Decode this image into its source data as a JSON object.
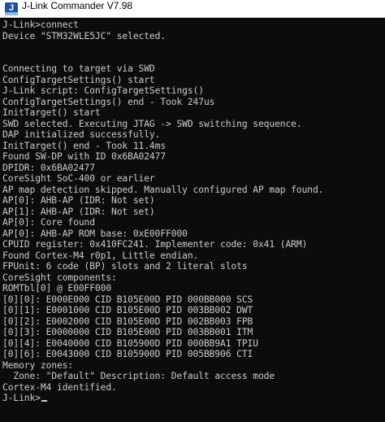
{
  "window": {
    "title": "J-Link Commander V7.98",
    "icon": "j-link-app-icon"
  },
  "console": {
    "lines": [
      "J-Link>connect",
      "Device \"STM32WLE5JC\" selected.",
      "",
      "",
      "Connecting to target via SWD",
      "ConfigTargetSettings() start",
      "J-Link script: ConfigTargetSettings()",
      "ConfigTargetSettings() end - Took 247us",
      "InitTarget() start",
      "SWD selected. Executing JTAG -> SWD switching sequence.",
      "DAP initialized successfully.",
      "InitTarget() end - Took 11.4ms",
      "Found SW-DP with ID 0x6BA02477",
      "DPIDR: 0x6BA02477",
      "CoreSight SoC-400 or earlier",
      "AP map detection skipped. Manually configured AP map found.",
      "AP[0]: AHB-AP (IDR: Not set)",
      "AP[1]: AHB-AP (IDR: Not set)",
      "AP[0]: Core found",
      "AP[0]: AHB-AP ROM base: 0xE00FF000",
      "CPUID register: 0x410FC241. Implementer code: 0x41 (ARM)",
      "Found Cortex-M4 r0p1, Little endian.",
      "FPUnit: 6 code (BP) slots and 2 literal slots",
      "CoreSight components:",
      "ROMTbl[0] @ E00FF000",
      "[0][0]: E000E000 CID B105E00D PID 000BB000 SCS",
      "[0][1]: E0001000 CID B105E00D PID 003BB002 DWT",
      "[0][2]: E0002000 CID B105E00D PID 002BB003 FPB",
      "[0][3]: E0000000 CID B105E00D PID 003BB001 ITM",
      "[0][4]: E0040000 CID B105900D PID 000BB9A1 TPIU",
      "[0][6]: E0043000 CID B105900D PID 005BB906 CTI",
      "Memory zones:",
      "  Zone: \"Default\" Description: Default access mode",
      "Cortex-M4 identified.",
      "J-Link>"
    ]
  }
}
